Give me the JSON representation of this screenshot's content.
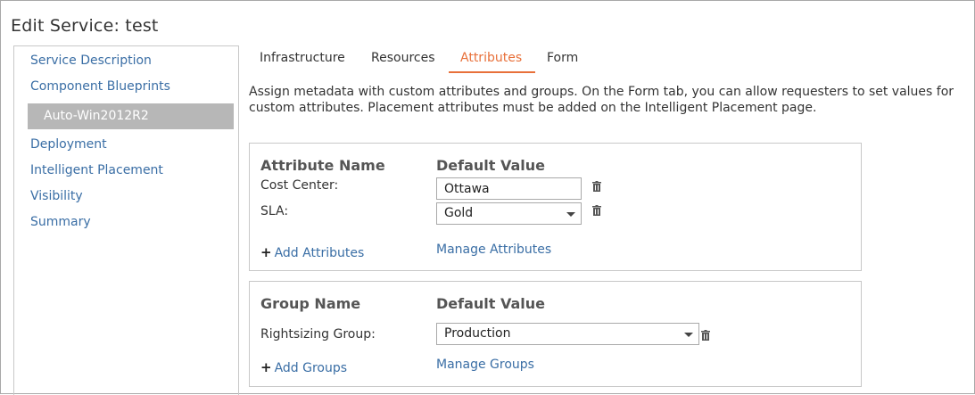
{
  "page": {
    "title": "Edit Service: test"
  },
  "sidebar": {
    "items": [
      {
        "label": "Service Description"
      },
      {
        "label": "Component Blueprints"
      },
      {
        "label": "Auto-Win2012R2",
        "selected": true
      },
      {
        "label": "Deployment"
      },
      {
        "label": "Intelligent Placement"
      },
      {
        "label": "Visibility"
      },
      {
        "label": "Summary"
      }
    ]
  },
  "tabs": [
    {
      "label": "Infrastructure"
    },
    {
      "label": "Resources"
    },
    {
      "label": "Attributes",
      "active": true
    },
    {
      "label": "Form"
    }
  ],
  "description": "Assign metadata with custom attributes and groups. On the Form tab, you can allow requesters to set values for custom attributes. Placement attributes must be added on the Intelligent Placement page.",
  "attributes_panel": {
    "col_name": "Attribute Name",
    "col_value": "Default Value",
    "rows": [
      {
        "label": "Cost Center:",
        "value": "Ottawa",
        "control": "text"
      },
      {
        "label": "SLA:",
        "value": "Gold",
        "control": "select"
      }
    ],
    "add_link": "Add Attributes",
    "manage_link": "Manage Attributes"
  },
  "groups_panel": {
    "col_name": "Group Name",
    "col_value": "Default Value",
    "rows": [
      {
        "label": "Rightsizing Group:",
        "value": "Production",
        "control": "select"
      }
    ],
    "add_link": "Add Groups",
    "manage_link": "Manage Groups"
  },
  "colors": {
    "accent_tab": "#e8703a",
    "link": "#3a6ea5",
    "selected_nav_bg": "#b7b7b7"
  }
}
